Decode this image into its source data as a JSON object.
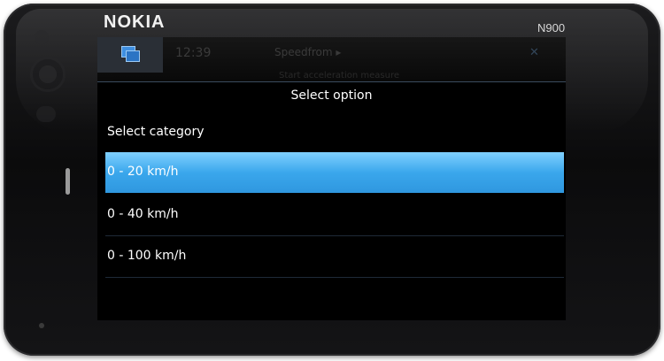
{
  "device": {
    "brand": "NOKIA",
    "model": "N900"
  },
  "statusbar": {
    "time": "12:39",
    "app_title": "Speedfrom ▸",
    "close_label": "✕",
    "subtitle": "Start acceleration measure"
  },
  "dialog": {
    "title": "Select option",
    "category_label": "Select category",
    "options": [
      {
        "label": "0 - 20 km/h",
        "selected": true
      },
      {
        "label": "0 - 40 km/h",
        "selected": false
      },
      {
        "label": "0 - 100 km/h",
        "selected": false
      }
    ]
  },
  "colors": {
    "selection": "#3aa7ec",
    "accent": "#3f8fe0",
    "background": "#000000"
  }
}
